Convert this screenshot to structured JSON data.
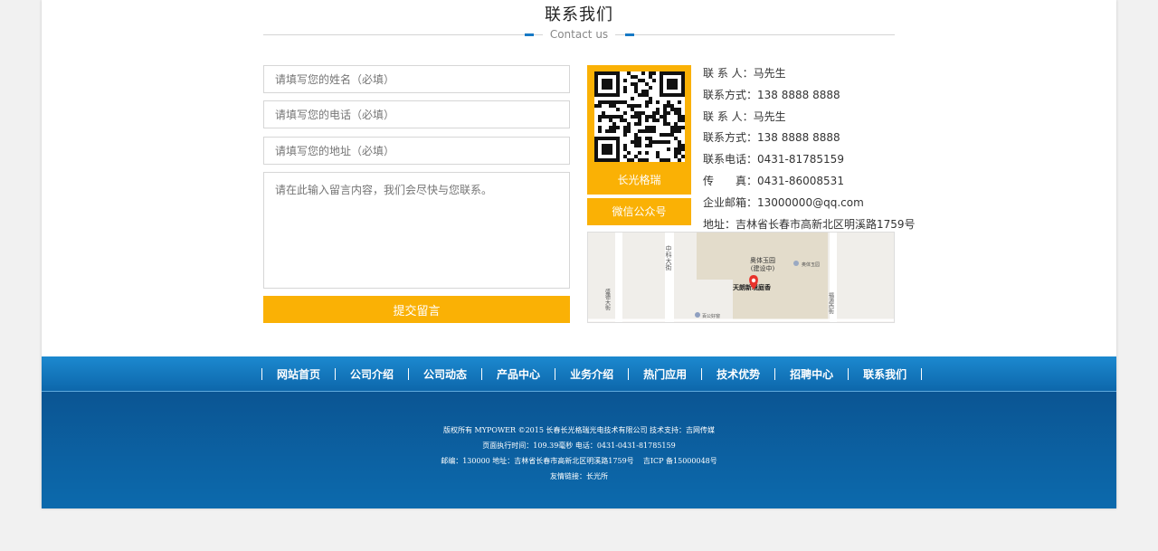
{
  "section": {
    "title": "联系我们",
    "subtitle": "Contact us"
  },
  "form": {
    "name_placeholder": "请填写您的姓名（必填）",
    "phone_placeholder": "请填写您的电话（必填）",
    "address_placeholder": "请填写您的地址（必填）",
    "message_placeholder": "请在此输入留言内容，我们会尽快与您联系。",
    "submit_label": "提交留言"
  },
  "qr": {
    "caption": "长光格瑞",
    "wechat_label": "微信公众号"
  },
  "contact_rows": [
    "联 系 人：马先生",
    "联系方式：138 8888 8888",
    "联 系 人：马先生",
    "联系方式：138 8888 8888",
    "联系电话：0431-81785159",
    "传　　真：0431-86008531",
    "企业邮箱：13000000@qq.com",
    "地址：吉林省长春市高新北区明溪路1759号"
  ],
  "map": {
    "road_left": "中科大街",
    "road_lower": "盛德大街",
    "road_right": "福源西街",
    "poi_main": "奥体玉园",
    "poi_main_note": "(建设中)",
    "poi_side": "奥体玉园",
    "poi_pin": "天朗新境庭香",
    "poi_small": "百公好窗"
  },
  "nav": [
    "网站首页",
    "公司介绍",
    "公司动态",
    "产品中心",
    "业务介绍",
    "热门应用",
    "技术优势",
    "招聘中心",
    "联系我们"
  ],
  "footer": {
    "line1": "版权所有 MYPOWER ©2015 长春长光格瑞光电技术有限公司 技术支持：吉网传媒",
    "line2": "页面执行时间：109.39毫秒 电话：0431-0431-81785159",
    "line3": "邮编：130000 地址：吉林省长春市高新北区明溪路1759号    吉ICP 备15000048号",
    "line4": "友情链接：长光所"
  },
  "colors": {
    "accent": "#fab105",
    "nav_top": "#1c89cf",
    "footer": "#0b5593",
    "title_dash": "#1679c5"
  }
}
